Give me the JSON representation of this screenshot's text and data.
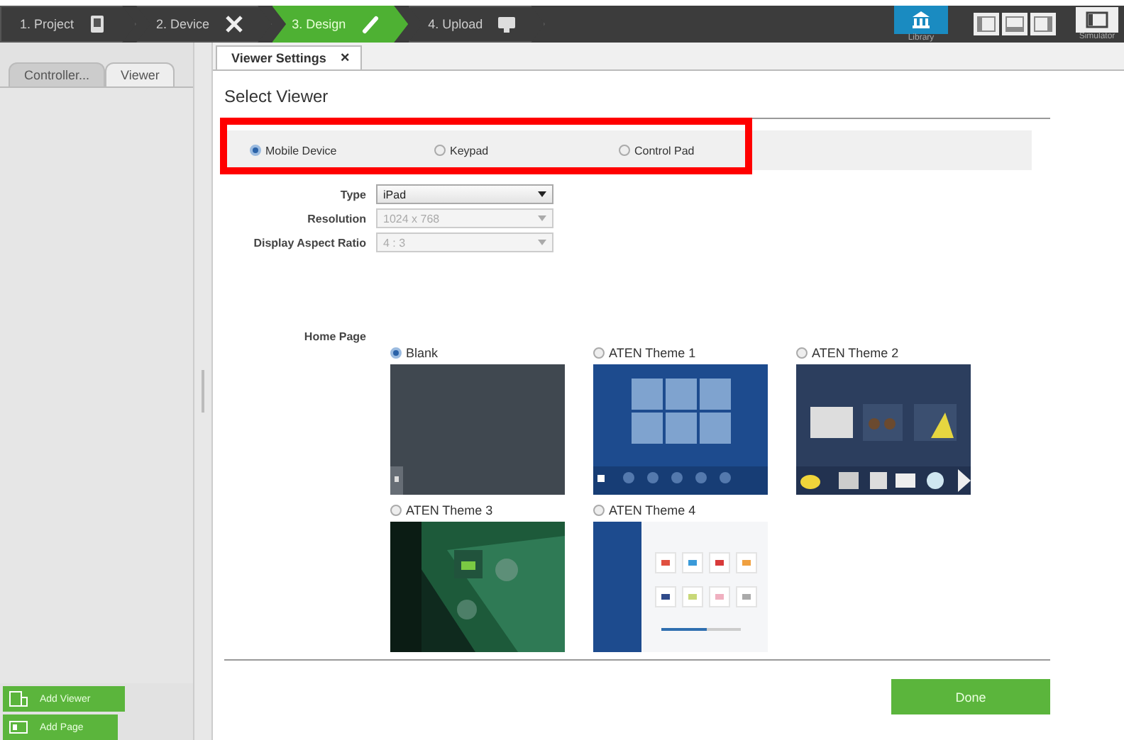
{
  "steps": [
    {
      "label": "1. Project",
      "selected": false
    },
    {
      "label": "2. Device",
      "selected": false
    },
    {
      "label": "3. Design",
      "selected": true
    },
    {
      "label": "4. Upload",
      "selected": false
    }
  ],
  "toolbar": {
    "library": "Library",
    "simulator": "Simulator"
  },
  "sidebar": {
    "tabs": [
      {
        "label": "Controller...",
        "selected": false
      },
      {
        "label": "Viewer",
        "selected": true
      }
    ],
    "buttons": [
      "Add Viewer",
      "Add Page"
    ]
  },
  "document_tabs": [
    {
      "label": "Viewer Settings",
      "close": "×",
      "selected": true
    }
  ],
  "heading": "Select Viewer",
  "viewer_types": {
    "highlighted": true,
    "options": [
      {
        "label": "Mobile Device",
        "selected": true
      },
      {
        "label": "Keypad",
        "selected": false
      },
      {
        "label": "Control Pad",
        "selected": false
      }
    ]
  },
  "fields": [
    {
      "label": "Type",
      "value": "iPad",
      "disabled": false
    },
    {
      "label": "Resolution",
      "value": "1024 x 768",
      "disabled": true
    },
    {
      "label": "Display Aspect Ratio",
      "value": "4 : 3",
      "disabled": true
    }
  ],
  "home_page": {
    "label": "Home Page",
    "themes": [
      {
        "label": "Blank",
        "selected": true,
        "kind": "blank"
      },
      {
        "label": "ATEN Theme 1",
        "selected": false,
        "kind": "tiles"
      },
      {
        "label": "ATEN Theme 2",
        "selected": false,
        "kind": "scenes"
      },
      {
        "label": "ATEN Theme 3",
        "selected": false,
        "kind": "green"
      },
      {
        "label": "ATEN Theme 4",
        "selected": false,
        "kind": "panel"
      }
    ]
  },
  "done": "Done"
}
